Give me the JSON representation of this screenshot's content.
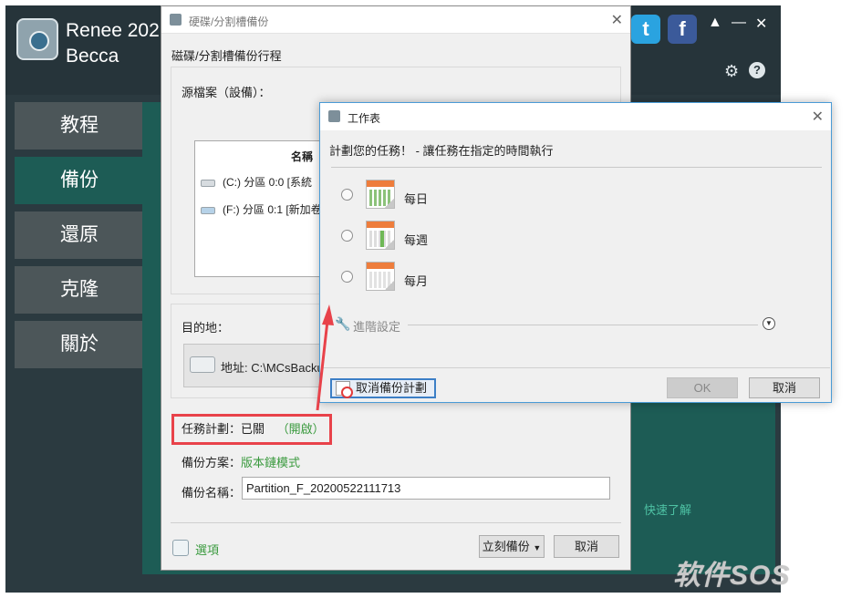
{
  "app": {
    "title_line1": "Renee 202",
    "title_line2": "Becca",
    "sidebar": [
      {
        "label": "教程"
      },
      {
        "label": "備份"
      },
      {
        "label": "還原"
      },
      {
        "label": "克隆"
      },
      {
        "label": "關於"
      }
    ],
    "quick_link": "快速了解"
  },
  "backup_dialog": {
    "title": "硬碟/分割槽備份",
    "section_title": "磁碟/分割槽備份行程",
    "source_label": "源檔案（設備）：",
    "list_header": "名稱",
    "disks": [
      {
        "label": "(C:) 分區 0:0 [系統"
      },
      {
        "label": "(F:) 分區 0:1 [新加卷"
      }
    ],
    "dest_label": "目的地：",
    "dest_address": "地址: C:\\MCsBacku",
    "task_plan_label": "任務計劃：已關",
    "task_plan_link": "（開啟）",
    "scheme_label": "備份方案：",
    "scheme_value": "版本鏈模式",
    "backup_name_label": "備份名稱：",
    "backup_name_value": "Partition_F_20200522111713",
    "options_label": "選項",
    "backup_now_label": "立刻備份",
    "cancel_label": "取消"
  },
  "schedule_dialog": {
    "title": "工作表",
    "heading": "計劃您的任務！ - 讓任務在指定的時間執行",
    "options": [
      {
        "label": "每日"
      },
      {
        "label": "每週"
      },
      {
        "label": "每月"
      }
    ],
    "advanced_label": "進階設定",
    "cancel_plan_label": "取消備份計劃",
    "ok_label": "OK",
    "cancel_label": "取消"
  },
  "watermark": "软件SOS",
  "colors": {
    "accent_green": "#1d5c55",
    "highlight_red": "#e8424a",
    "link_green": "#3a9a3e"
  }
}
